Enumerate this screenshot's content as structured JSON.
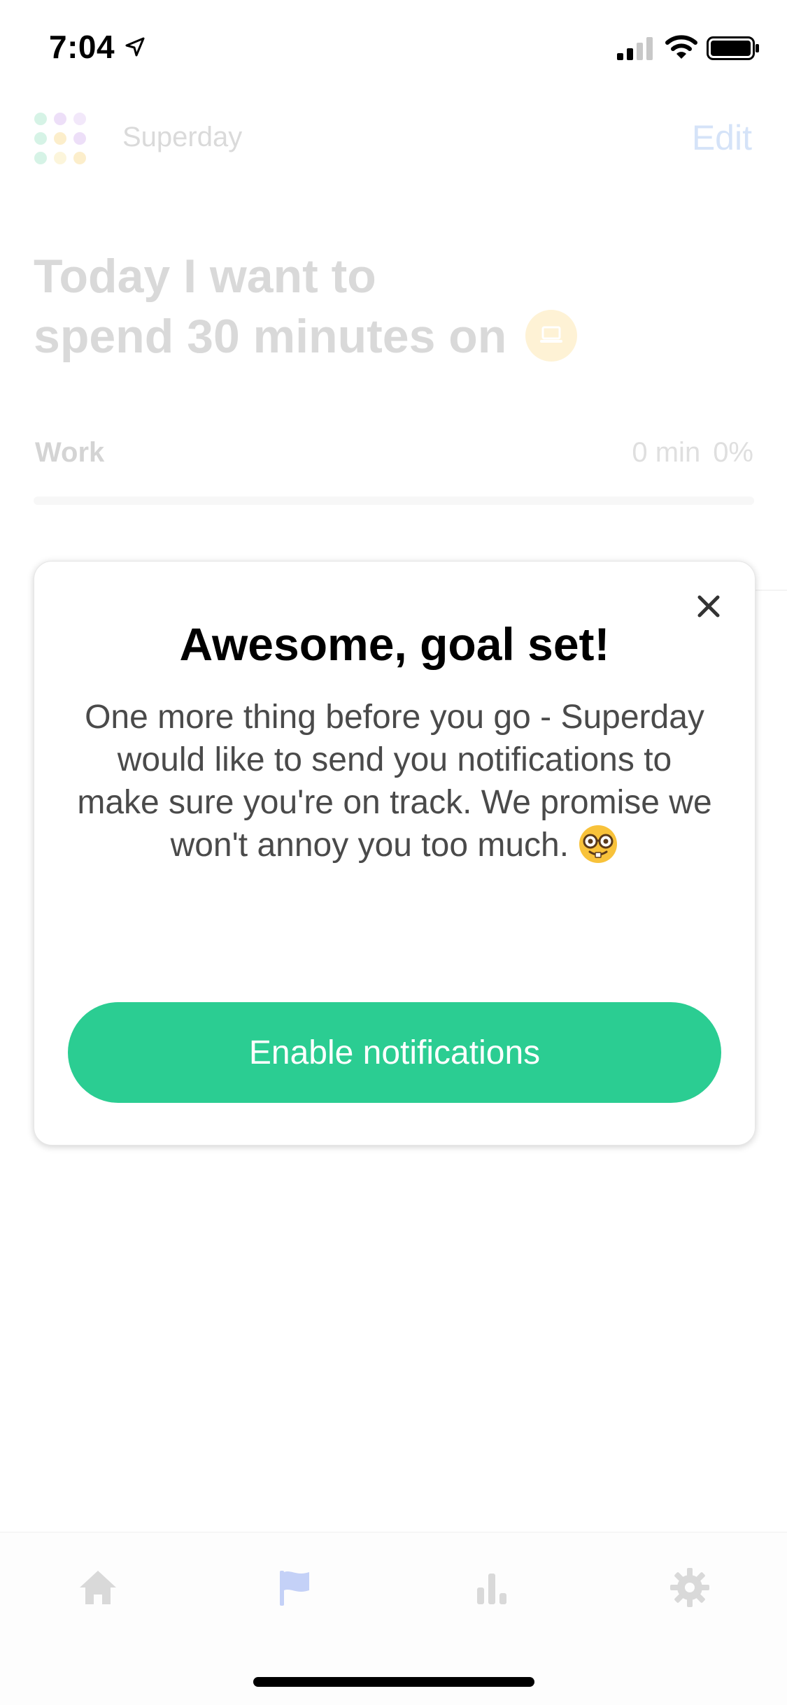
{
  "status_bar": {
    "time": "7:04"
  },
  "header": {
    "app_name": "Superday",
    "edit_label": "Edit"
  },
  "goal": {
    "headline_line1": "Today I want to",
    "headline_line2": "spend 30 minutes on",
    "category_icon": "laptop-icon",
    "category_color": "#fbd67a"
  },
  "category_row": {
    "label": "Work",
    "minutes": "0 min",
    "percent": "0%",
    "progress": 0
  },
  "modal": {
    "title": "Awesome, goal set!",
    "body": "One more thing before you go - Superday would like to send you notifications to make sure you're on track. We promise we won't annoy you too much.",
    "emoji": "nerd-face-emoji",
    "button_label": "Enable notifications",
    "button_color": "#2bcd92"
  },
  "tab_bar": {
    "tabs": [
      "home-icon",
      "flag-icon",
      "chart-icon",
      "gear-icon"
    ],
    "active_tab": "flag-icon",
    "active_color": "#4a73e8"
  }
}
